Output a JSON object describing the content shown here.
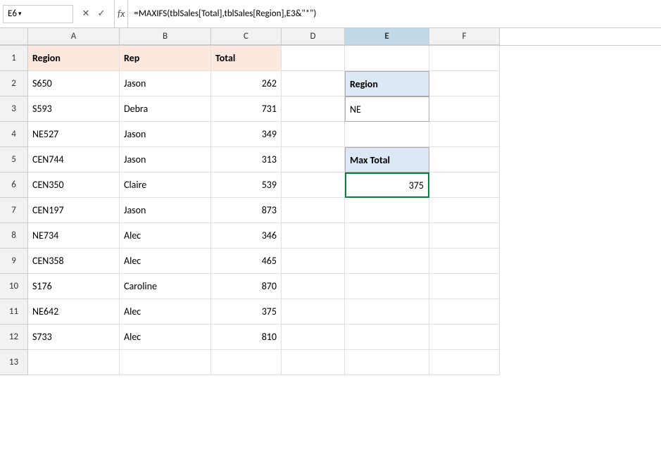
{
  "formulaBar": {
    "cellRef": "E6",
    "formula": "=MAXIFS(tblSales[Total],tblSales[Region],E3&\"*\")",
    "cancelLabel": "✕",
    "confirmLabel": "✓",
    "fxLabel": "fx"
  },
  "columns": {
    "headers": [
      "A",
      "B",
      "C",
      "D",
      "E",
      "F"
    ]
  },
  "rows": [
    {
      "rowNum": "1",
      "a": "Region",
      "b": "Rep",
      "c": "Total",
      "d": "",
      "e": "",
      "f": "",
      "isHeader": true
    },
    {
      "rowNum": "2",
      "a": "S650",
      "b": "Jason",
      "c": "262",
      "d": "",
      "e": "",
      "f": ""
    },
    {
      "rowNum": "3",
      "a": "S593",
      "b": "Debra",
      "c": "731",
      "d": "",
      "e": "NE",
      "f": "",
      "eType": "region-value"
    },
    {
      "rowNum": "4",
      "a": "NE527",
      "b": "Jason",
      "c": "349",
      "d": "",
      "e": "",
      "f": ""
    },
    {
      "rowNum": "5",
      "a": "CEN744",
      "b": "Jason",
      "c": "313",
      "d": "",
      "e": "Max Total",
      "f": "",
      "eType": "maxtotal-box"
    },
    {
      "rowNum": "6",
      "a": "CEN350",
      "b": "Claire",
      "c": "539",
      "d": "",
      "e": "375",
      "f": "",
      "eType": "maxtotal-value"
    },
    {
      "rowNum": "7",
      "a": "CEN197",
      "b": "Jason",
      "c": "873",
      "d": "",
      "e": "",
      "f": ""
    },
    {
      "rowNum": "8",
      "a": "NE734",
      "b": "Alec",
      "c": "346",
      "d": "",
      "e": "",
      "f": ""
    },
    {
      "rowNum": "9",
      "a": "CEN358",
      "b": "Alec",
      "c": "465",
      "d": "",
      "e": "",
      "f": ""
    },
    {
      "rowNum": "10",
      "a": "S176",
      "b": "Caroline",
      "c": "870",
      "d": "",
      "e": "",
      "f": ""
    },
    {
      "rowNum": "11",
      "a": "NE642",
      "b": "Alec",
      "c": "375",
      "d": "",
      "e": "",
      "f": ""
    },
    {
      "rowNum": "12",
      "a": "S733",
      "b": "Alec",
      "c": "810",
      "d": "",
      "e": "",
      "f": ""
    },
    {
      "rowNum": "13",
      "a": "",
      "b": "",
      "c": "",
      "d": "",
      "e": "",
      "f": ""
    }
  ],
  "sidebar": {
    "regionLabel": "Region",
    "regionValue": "NE",
    "maxTotalLabel": "Max Total",
    "maxTotalValue": "375"
  }
}
